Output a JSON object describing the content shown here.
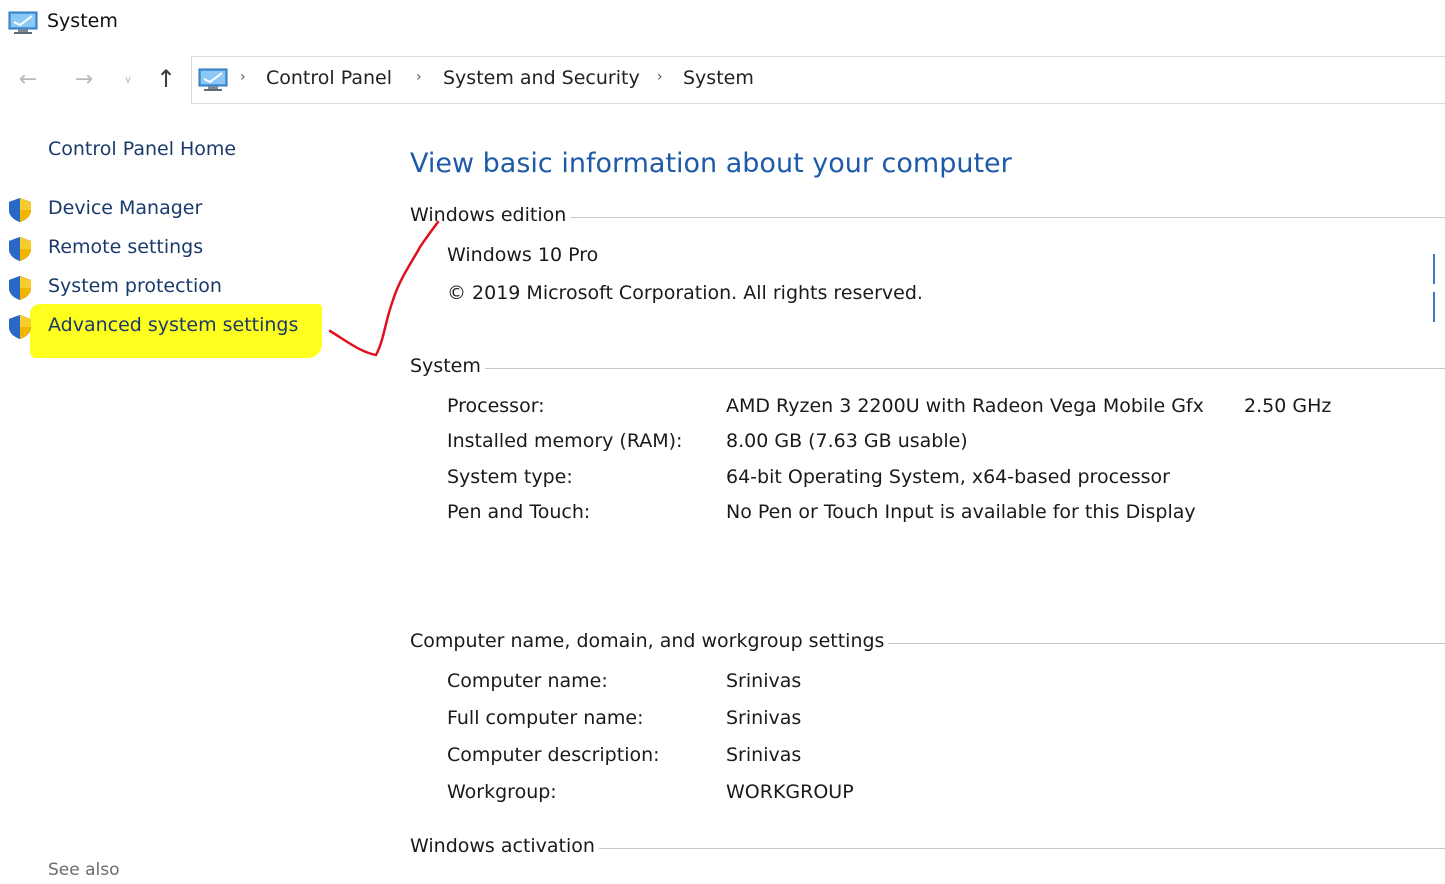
{
  "window": {
    "title": "System"
  },
  "nav": {
    "breadcrumbs": [
      "Control Panel",
      "System and Security",
      "System"
    ]
  },
  "left_pane": {
    "home_link": "Control Panel Home",
    "tasks": [
      "Device Manager",
      "Remote settings",
      "System protection",
      "Advanced system settings"
    ],
    "see_also": "See also"
  },
  "main": {
    "heading": "View basic information about your computer",
    "windows_edition": {
      "title": "Windows edition",
      "edition": "Windows 10 Pro",
      "copyright": "© 2019 Microsoft Corporation. All rights reserved."
    },
    "system": {
      "title": "System",
      "rows": [
        {
          "label": "Processor:",
          "value": "AMD Ryzen 3 2200U with Radeon Vega Mobile Gfx",
          "extra": "2.50 GHz"
        },
        {
          "label": "Installed memory (RAM):",
          "value": "8.00 GB (7.63 GB usable)"
        },
        {
          "label": "System type:",
          "value": "64-bit Operating System, x64-based processor"
        },
        {
          "label": "Pen and Touch:",
          "value": "No Pen or Touch Input is available for this Display"
        }
      ]
    },
    "computer_name": {
      "title": "Computer name, domain, and workgroup settings",
      "rows": [
        {
          "label": "Computer name:",
          "value": "Srinivas"
        },
        {
          "label": "Full computer name:",
          "value": "Srinivas"
        },
        {
          "label": "Computer description:",
          "value": "Srinivas"
        },
        {
          "label": "Workgroup:",
          "value": "WORKGROUP"
        }
      ]
    },
    "activation": {
      "title": "Windows activation"
    }
  },
  "colors": {
    "link": "#1a3a6a",
    "heading": "#1e5aa8",
    "highlight": "#ffff1e",
    "annotation": "#e0101e"
  }
}
